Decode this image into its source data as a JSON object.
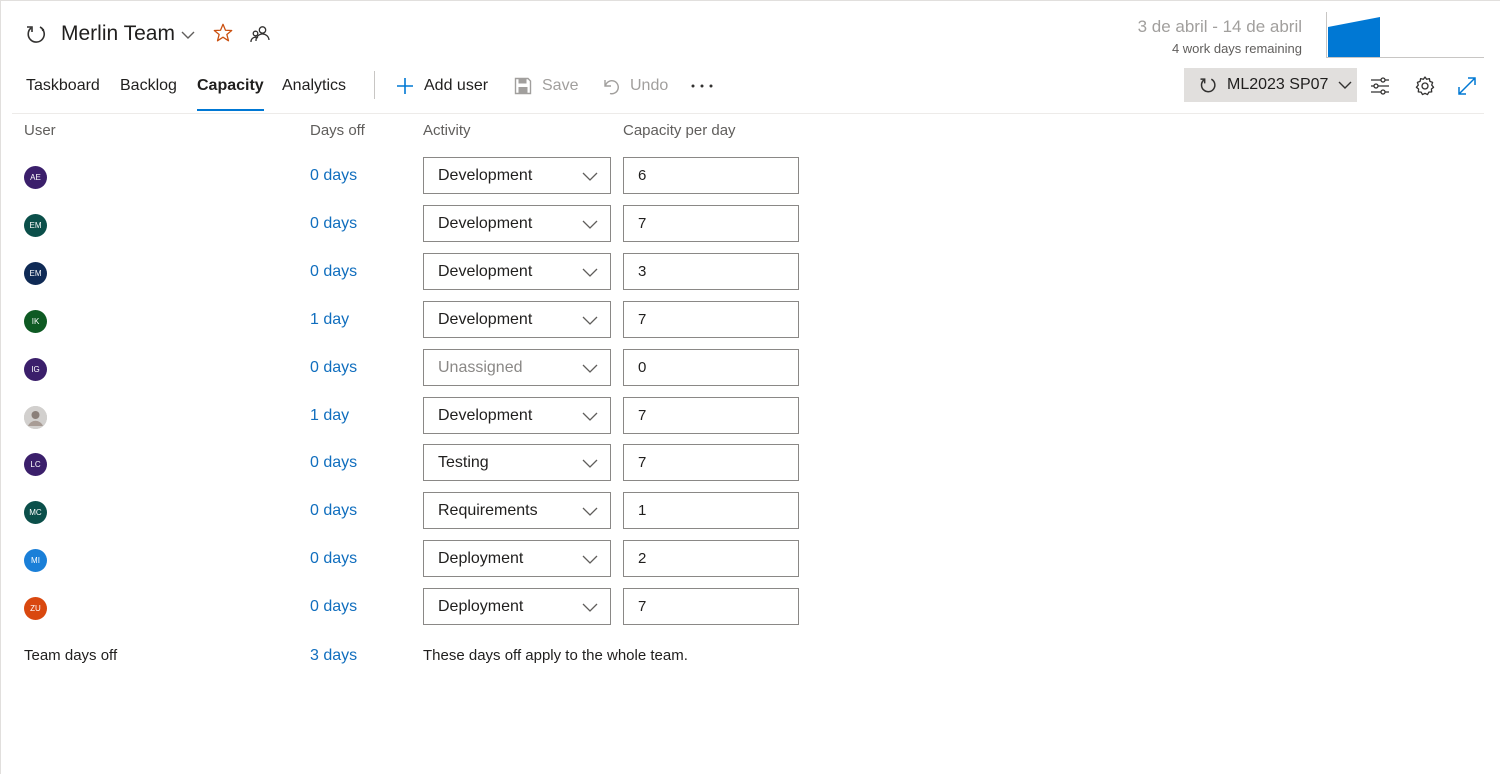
{
  "header": {
    "team_name": "Merlin Team",
    "date_range": "3 de abril - 14 de abril",
    "remaining": "4 work days remaining",
    "accent_color": "#0078d4"
  },
  "tabs": [
    {
      "label": "Taskboard",
      "active": false
    },
    {
      "label": "Backlog",
      "active": false
    },
    {
      "label": "Capacity",
      "active": true
    },
    {
      "label": "Analytics",
      "active": false
    }
  ],
  "toolbar": {
    "add_user_label": "Add user",
    "save_label": "Save",
    "undo_label": "Undo",
    "sprint_label": "ML2023 SP07"
  },
  "columns": {
    "user": "User",
    "days_off": "Days off",
    "activity": "Activity",
    "capacity": "Capacity per day"
  },
  "users": [
    {
      "initials": "AE",
      "color": "#3b1f6b",
      "days_off": "0 days",
      "activity": "Development",
      "capacity": "6"
    },
    {
      "initials": "EM",
      "color": "#0b4f4a",
      "days_off": "0 days",
      "activity": "Development",
      "capacity": "7"
    },
    {
      "initials": "EM",
      "color": "#0f2a55",
      "days_off": "0 days",
      "activity": "Development",
      "capacity": "3"
    },
    {
      "initials": "IK",
      "color": "#0e5a23",
      "days_off": "1 day",
      "activity": "Development",
      "capacity": "7"
    },
    {
      "initials": "IG",
      "color": "#3b1f6b",
      "days_off": "0 days",
      "activity": "Unassigned",
      "capacity": "0"
    },
    {
      "initials": "",
      "color": "#c8c6c4",
      "days_off": "1 day",
      "activity": "Development",
      "capacity": "7"
    },
    {
      "initials": "LC",
      "color": "#3b1f6b",
      "days_off": "0 days",
      "activity": "Testing",
      "capacity": "7"
    },
    {
      "initials": "MC",
      "color": "#0b4f4a",
      "days_off": "0 days",
      "activity": "Requirements",
      "capacity": "1"
    },
    {
      "initials": "MI",
      "color": "#1a7fd8",
      "days_off": "0 days",
      "activity": "Deployment",
      "capacity": "2"
    },
    {
      "initials": "ZU",
      "color": "#d9480f",
      "days_off": "0 days",
      "activity": "Deployment",
      "capacity": "7"
    }
  ],
  "team_days_off": {
    "label": "Team days off",
    "days": "3 days",
    "note": "These days off apply to the whole team."
  }
}
